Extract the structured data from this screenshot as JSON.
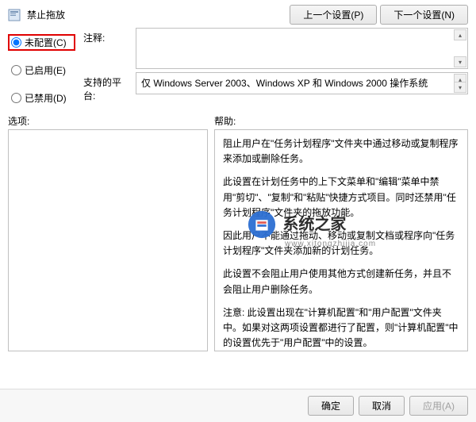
{
  "header": {
    "title": "禁止拖放",
    "prev_button": "上一个设置(P)",
    "next_button": "下一个设置(N)"
  },
  "radios": {
    "not_configured": "未配置(C)",
    "enabled": "已启用(E)",
    "disabled": "已禁用(D)",
    "selected": "not_configured"
  },
  "fields": {
    "comment_label": "注释:",
    "comment_value": "",
    "platform_label": "支持的平台:",
    "platform_value": "仅 Windows Server 2003、Windows XP 和 Windows 2000 操作系统"
  },
  "section_labels": {
    "options": "选项:",
    "help": "帮助:"
  },
  "help_text": {
    "p1": "阻止用户在\"任务计划程序\"文件夹中通过移动或复制程序来添加或删除任务。",
    "p2": "此设置在计划任务中的上下文菜单和\"编辑\"菜单中禁用\"剪切\"、\"复制\"和\"粘贴\"快捷方式项目。同时还禁用\"任务计划程序\"文件夹的拖放功能。",
    "p3": "因此用户不能通过拖动、移动或复制文档或程序向\"任务计划程序\"文件夹添加新的计划任务。",
    "p4": "此设置不会阻止用户使用其他方式创建新任务，并且不会阻止用户删除任务。",
    "p5": "注意: 此设置出现在\"计算机配置\"和\"用户配置\"文件夹中。如果对这两项设置都进行了配置，则\"计算机配置\"中的设置优先于\"用户配置\"中的设置。"
  },
  "watermark": {
    "title": "系统之家",
    "sub": "www.xitongzhijia.com"
  },
  "footer": {
    "ok": "确定",
    "cancel": "取消",
    "apply": "应用(A)"
  }
}
